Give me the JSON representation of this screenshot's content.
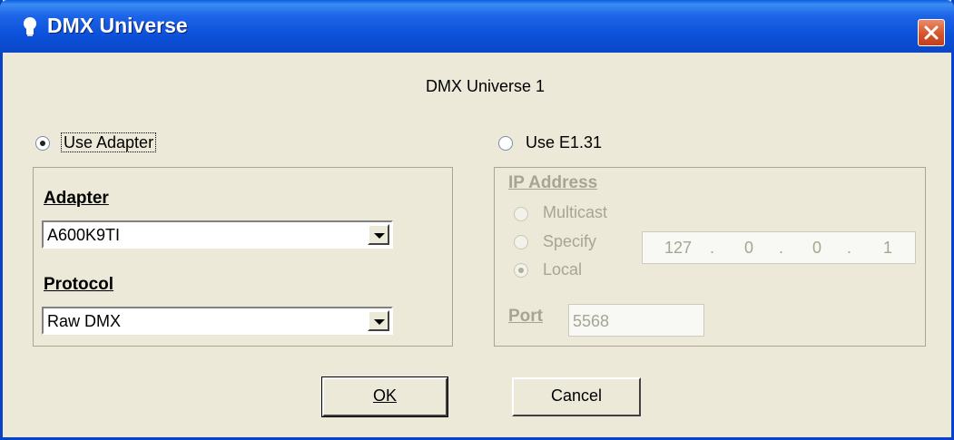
{
  "window": {
    "title": "DMX Universe",
    "heading": "DMX Universe 1"
  },
  "source": {
    "use_adapter_label": "Use Adapter",
    "use_adapter_selected": true,
    "use_e131_label": "Use E1.31",
    "use_e131_selected": false
  },
  "adapter_group": {
    "adapter_heading": "Adapter",
    "adapter_value": "A600K9TI",
    "protocol_heading": "Protocol",
    "protocol_value": "Raw DMX"
  },
  "e131_group": {
    "ip_heading": "IP Address",
    "multicast_label": "Multicast",
    "specify_label": "Specify",
    "local_label": "Local",
    "selected_mode": "Local",
    "ip": [
      "127",
      "0",
      "0",
      "1"
    ],
    "ip_dot": ".",
    "port_label": "Port",
    "port_value": "5568",
    "enabled": false
  },
  "buttons": {
    "ok": "OK",
    "cancel": "Cancel"
  },
  "colors": {
    "title_bar": "#0b4fd8",
    "dialog_bg": "#ece9d8",
    "disabled_text": "#a7a592",
    "close_button": "#d6542b"
  },
  "icons": {
    "title_icon": "lightbulb-icon",
    "close_icon": "close-icon",
    "dropdown_icon": "chevron-down-icon"
  }
}
